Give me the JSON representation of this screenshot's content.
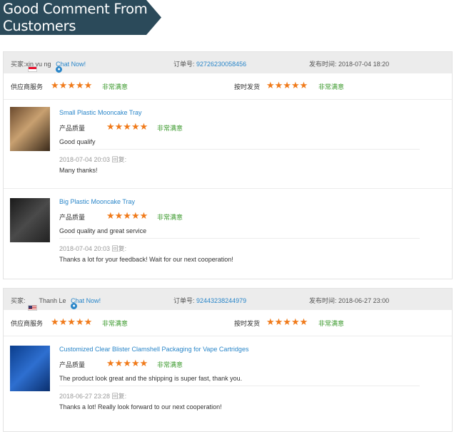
{
  "banner": {
    "line1": "Good Comment From",
    "line2": "Customers"
  },
  "labels": {
    "buyer": "买家:",
    "chat": "Chat Now!",
    "order": "订单号:",
    "published": "发布时间:",
    "supplier_service": "供应商服务",
    "on_time": "按时发货",
    "quality": "产品质量",
    "satisfaction": "非常满意",
    "reply": "回复:"
  },
  "stars": "★★★★★",
  "reviews": [
    {
      "buyer": "xin yu ng",
      "flag": "singapore-flag",
      "order_no": "92726230058456",
      "time": "2018-07-04 18:20",
      "items": [
        {
          "product": "Small Plastic Mooncake Tray",
          "comment": "Good qualify",
          "reply_time": "2018-07-04 20:03",
          "reply": "Many thanks!"
        },
        {
          "product": "Big Plastic Mooncake Tray",
          "comment": "Good quality and great service",
          "reply_time": "2018-07-04 20:03",
          "reply": "Thanks a lot for your feedback! Wait for our next cooperation!"
        }
      ]
    },
    {
      "buyer": "Thanh Le",
      "flag": "usa-flag",
      "order_no": "92443238244979",
      "time": "2018-06-27 23:00",
      "items": [
        {
          "product": "Customized Clear Blister Clamshell Packaging for Vape Cartridges",
          "comment": "The product look great and the shipping is super fast, thank you.",
          "reply_time": "2018-06-27 23:28",
          "reply": "Thanks a lot! Really look forward to our next cooperation!"
        }
      ]
    }
  ]
}
